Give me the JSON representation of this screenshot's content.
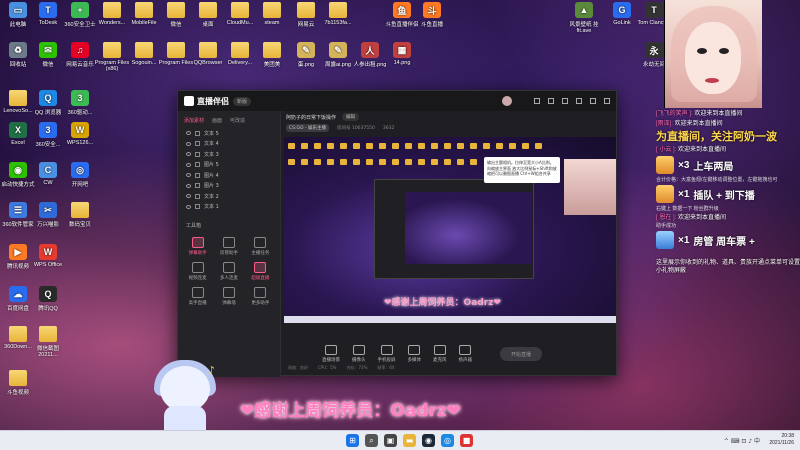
{
  "desktop_icons": [
    {
      "label": "此电脑",
      "type": "app",
      "color": "#4a90e2",
      "glyph": "▭"
    },
    {
      "label": "ToDesk",
      "type": "app",
      "color": "#2a6cf0",
      "glyph": "T"
    },
    {
      "label": "360安全卫士",
      "type": "app",
      "color": "#3cba54",
      "glyph": "+"
    },
    {
      "label": "Wonders...",
      "type": "folder"
    },
    {
      "label": "MobileFile",
      "type": "folder"
    },
    {
      "label": "微信",
      "type": "folder"
    },
    {
      "label": "桌面",
      "type": "folder"
    },
    {
      "label": "CloudMu...",
      "type": "folder"
    },
    {
      "label": "steam",
      "type": "folder"
    },
    {
      "label": "网易云",
      "type": "folder"
    },
    {
      "label": "7b1153fa...",
      "type": "folder"
    },
    {
      "label": "斗鱼直播伴侣",
      "type": "app",
      "color": "#ff7a22",
      "glyph": "鱼"
    },
    {
      "label": "斗鱼直播",
      "type": "app",
      "color": "#ff7a22",
      "glyph": "斗"
    },
    {
      "label": "回收站",
      "type": "app",
      "color": "#6c7a89",
      "glyph": "♻"
    },
    {
      "label": "微信",
      "type": "app",
      "color": "#2dc100",
      "glyph": "✉"
    },
    {
      "label": "网易云音乐",
      "type": "app",
      "color": "#e60026",
      "glyph": "♫"
    },
    {
      "label": "Program Files (x86)",
      "type": "folder"
    },
    {
      "label": "Sogouin...",
      "type": "folder"
    },
    {
      "label": "Program Files",
      "type": "folder"
    },
    {
      "label": "QQBrowser",
      "type": "folder"
    },
    {
      "label": "Delivery...",
      "type": "folder"
    },
    {
      "label": "美团美",
      "type": "folder"
    },
    {
      "label": "蛋.png",
      "type": "app",
      "color": "#d4b35a",
      "glyph": "✎"
    },
    {
      "label": "周露ai.png",
      "type": "app",
      "color": "#d4b35a",
      "glyph": "✎"
    },
    {
      "label": "人参出租.png",
      "type": "app",
      "color": "#c04040",
      "glyph": "人"
    },
    {
      "label": "14.png",
      "type": "app",
      "color": "#c04040",
      "glyph": "▦"
    },
    {
      "label": "LenovoSo...",
      "type": "folder"
    },
    {
      "label": "QQ 浏览器",
      "type": "app",
      "color": "#1e88e5",
      "glyph": "Q"
    },
    {
      "label": "360驱动...",
      "type": "app",
      "color": "#3cba54",
      "glyph": "3"
    },
    {
      "label": "Excel",
      "type": "app",
      "color": "#1e7145",
      "glyph": "X"
    },
    {
      "label": "360安全...",
      "type": "app",
      "color": "#2a6cf0",
      "glyph": "3"
    },
    {
      "label": "WPS126...",
      "type": "app",
      "color": "#d9a400",
      "glyph": "W"
    },
    {
      "label": "启动快捷方式",
      "type": "app",
      "color": "#2dc100",
      "glyph": "◉"
    },
    {
      "label": "CW",
      "type": "app",
      "color": "#4a90e2",
      "glyph": "C"
    },
    {
      "label": "开网吧",
      "type": "app",
      "color": "#2a6cf0",
      "glyph": "◎"
    },
    {
      "label": "360软件管家",
      "type": "app",
      "color": "#3c7be0",
      "glyph": "☰"
    },
    {
      "label": "万兴喵影",
      "type": "app",
      "color": "#2e6ad8",
      "glyph": "✂"
    },
    {
      "label": "数码宝贝",
      "type": "folder"
    },
    {
      "label": "腾讯视频",
      "type": "app",
      "color": "#ff7a22",
      "glyph": "▶"
    },
    {
      "label": "WPS Office",
      "type": "app",
      "color": "#e63b2e",
      "glyph": "W"
    },
    {
      "label": "百度网盘",
      "type": "app",
      "color": "#2a6cf0",
      "glyph": "☁"
    },
    {
      "label": "腾讯QQ",
      "type": "app",
      "color": "#2a2a2a",
      "glyph": "Q"
    },
    {
      "label": "360Down...",
      "type": "folder"
    },
    {
      "label": "微信截图 20211...",
      "type": "folder"
    },
    {
      "label": "斗鱼视频",
      "type": "folder"
    },
    {
      "label": "风景壁纸 挂 fit.ave",
      "type": "app",
      "color": "#5a8a3a",
      "glyph": "▲"
    },
    {
      "label": "GoLink",
      "type": "app",
      "color": "#2a6cf0",
      "glyph": "G"
    },
    {
      "label": "Tom Clancy...",
      "type": "app",
      "color": "#333",
      "glyph": "T"
    },
    {
      "label": "永劫无间",
      "type": "app",
      "color": "#333",
      "glyph": "永"
    }
  ],
  "app_window": {
    "title": "直播伴侣",
    "version": "新版",
    "left_tabs": [
      "添加素材",
      "画面",
      "可改造"
    ],
    "sources": [
      "文本 5",
      "文本 4",
      "文本 3",
      "图片 5",
      "图片 4",
      "图片 3",
      "文本 2",
      "文本 1"
    ],
    "tools_title": "工具箱",
    "tools": [
      {
        "label": "弹幕助手",
        "hot": true
      },
      {
        "label": "房管助手",
        "hot": false
      },
      {
        "label": "主播任务",
        "hot": false
      },
      {
        "label": "视频连麦",
        "hot": false
      },
      {
        "label": "多人连麦",
        "hot": false
      },
      {
        "label": "超级直播",
        "hot": true
      },
      {
        "label": "高手直播",
        "hot": false
      },
      {
        "label": "弹幕墙",
        "hot": false
      },
      {
        "label": "更多助手",
        "hot": false
      }
    ],
    "scene_title": "阿奶子的日常下饭操作",
    "scene_chip": "编辑",
    "info_tag": "CS:GO - 娱乐主播",
    "info_room": "房间号 10037550",
    "info_count": "3632",
    "preview_thanks": "❤感谢上周饲养员：Oadrz❤",
    "preview_tooltip": "输出主题相机。拉伸至宽大小A比例。向缩放主界面 放大比例鼠标+Shift和放缩把可以删图直播 Ctrl+W组合共享",
    "controls": [
      "直播场景",
      "摄像头",
      "手机投屏",
      "多媒体",
      "麦克风",
      "扬声器"
    ],
    "start_live": "开始直播",
    "status": [
      "网络：良好",
      "CPU：5%",
      "内存：73%",
      "帧率：60"
    ]
  },
  "chat": {
    "lines": [
      {
        "user": "[飞飞的笑声 ]:",
        "text": " 欢迎来到本直播间"
      },
      {
        "user": "[雨泽]:",
        "text": " 欢迎来到本直播间"
      },
      {
        "user": "[ 小云 ]:",
        "text": " 欢迎来到本直播间"
      },
      {
        "user": "[ 恩在 ]:",
        "text": " 欢迎来到本直播间"
      }
    ],
    "big_text": "为直播间，关注阿奶一波",
    "gift1_count": "×3",
    "gift1_text": "上车两局",
    "gift1_note": "合计价格：大富鱼翅/左键移动调整位置，左键拖拽也可",
    "gift2_count": "×1",
    "gift2_text": "插队 + 到下播",
    "gift2_note": "右键上 数据一下 粉丝群升级",
    "gift3_note": "助手成功",
    "gift3_count": "×1",
    "gift3_text": "房管 周车票 +",
    "notice": "这里展示你收到的礼物、道具、贵族开通点菜单可设置小礼物屏蔽"
  },
  "banner_thanks": "❤感谢上周饲养员：Oadrz❤",
  "taskbar": {
    "apps": [
      {
        "name": "windows-start",
        "color": "#1a73e8",
        "glyph": "⊞"
      },
      {
        "name": "search",
        "color": "#555",
        "glyph": "⌕"
      },
      {
        "name": "task-view",
        "color": "#444",
        "glyph": "▣"
      },
      {
        "name": "file-explorer",
        "color": "#e8b43a",
        "glyph": "▬"
      },
      {
        "name": "steam",
        "color": "#1b2838",
        "glyph": "◉"
      },
      {
        "name": "browser",
        "color": "#1e88e5",
        "glyph": "◎"
      },
      {
        "name": "app",
        "color": "#d33",
        "glyph": "■"
      }
    ],
    "tray": "^ ⌨ ⊡ ♪ 中",
    "time": "20:38",
    "date": "2021/11/26"
  },
  "colors": {
    "accent": "#ff5c8a",
    "gift_yellow": "#ffd84a",
    "banner_pink": "#ff7fc0"
  }
}
